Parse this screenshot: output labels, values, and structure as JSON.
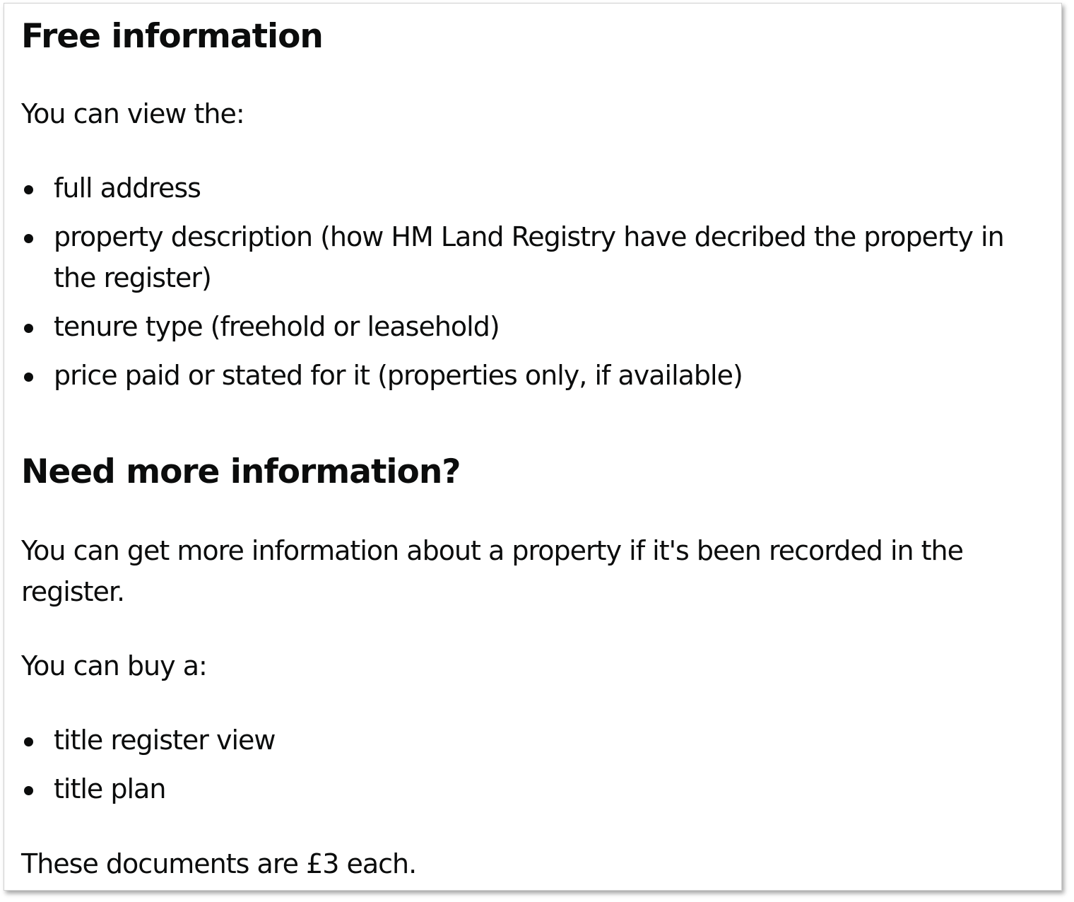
{
  "free_section": {
    "heading": "Free information",
    "intro": "You can view the:",
    "items": [
      "full address",
      "property description (how HM Land Registry have decribed the property in the register)",
      "tenure type (freehold or leasehold)",
      "price paid or stated for it (properties only, if available)"
    ]
  },
  "more_section": {
    "heading": "Need more information?",
    "intro": "You can get more information about a property if it's been recorded in the register.",
    "buy_intro": "You can buy a:",
    "items": [
      "title register view",
      "title plan"
    ],
    "price_note": "These documents are £3 each."
  }
}
